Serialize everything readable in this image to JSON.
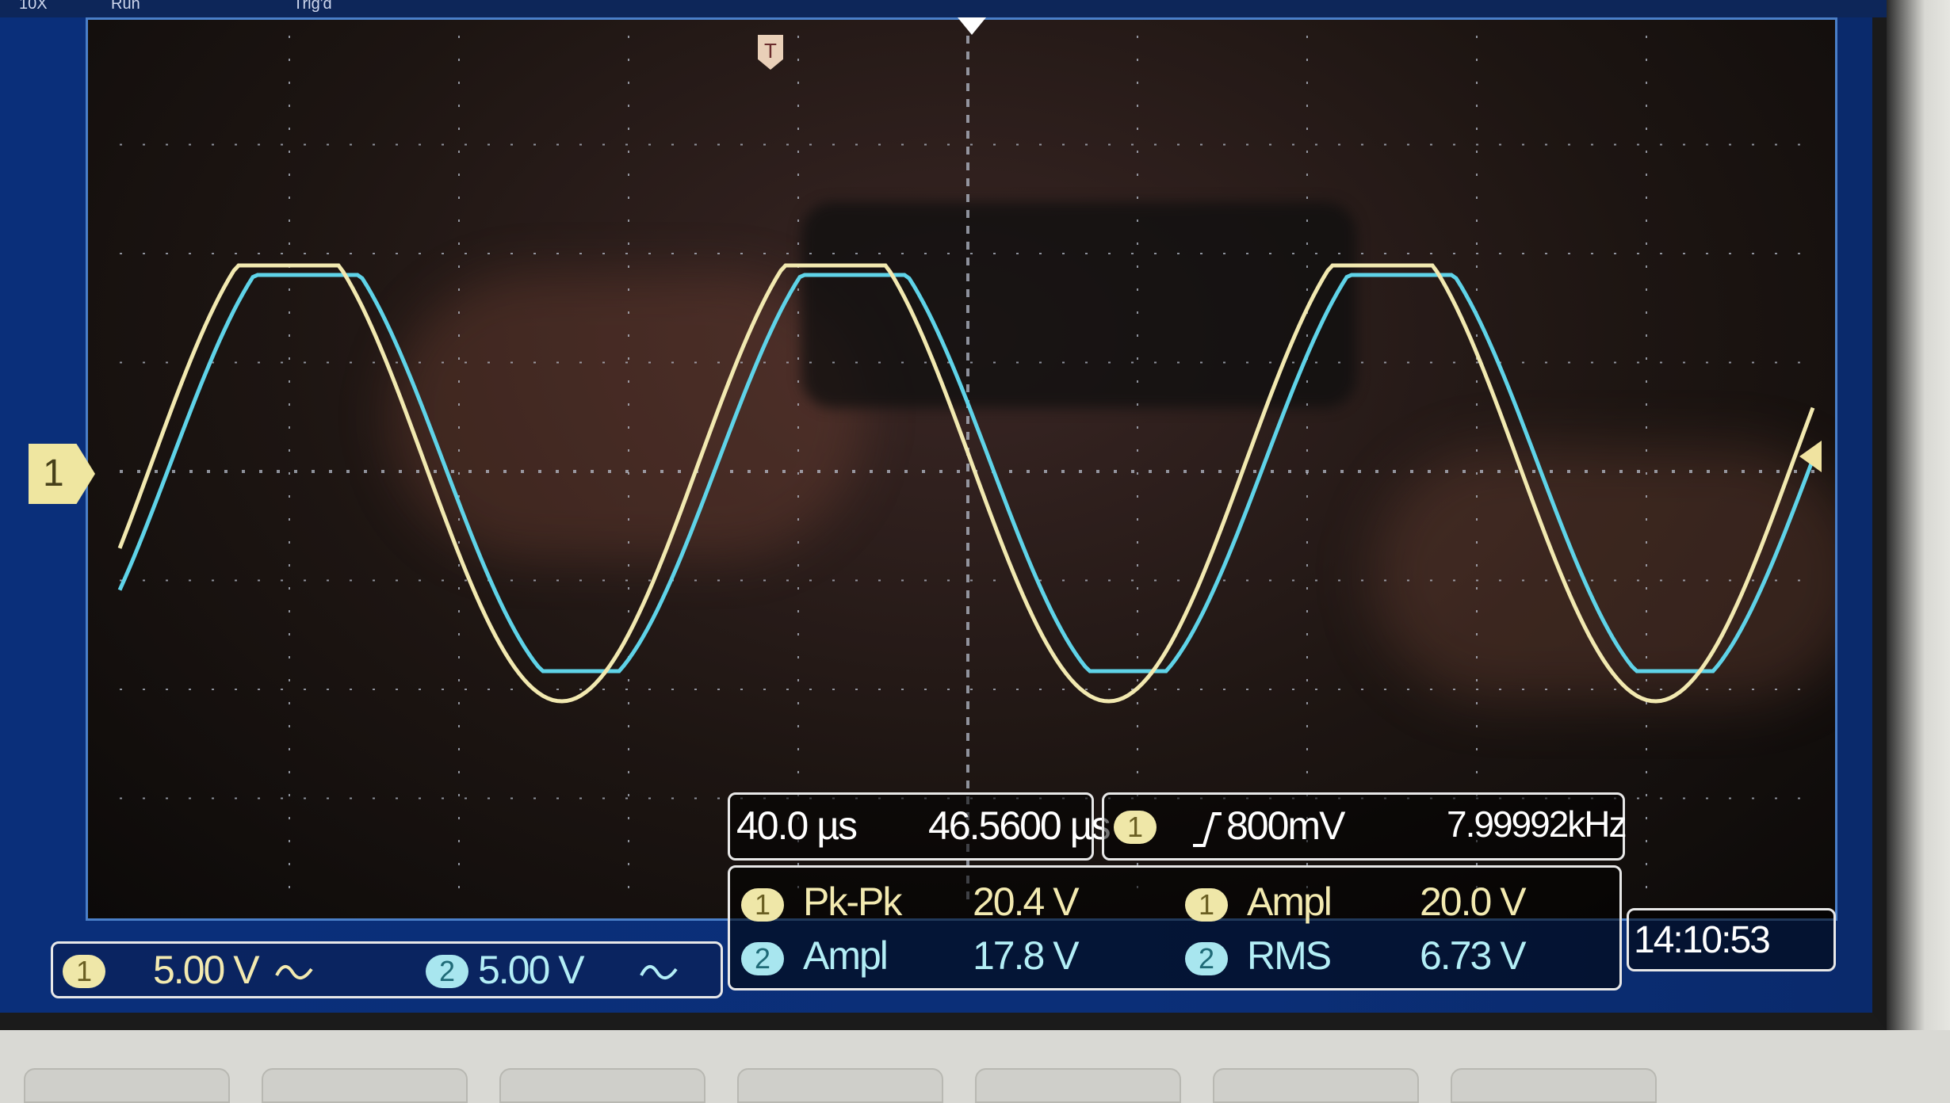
{
  "top_status": {
    "left": "10X",
    "mode": "Run",
    "trigger": "Trig'd"
  },
  "channel_marker": {
    "label": "1"
  },
  "trigger_marker": {
    "label": "T"
  },
  "timebase": {
    "scale": "40.0 µs",
    "delay": "46.5600 µs"
  },
  "trigger": {
    "source": "1",
    "slope_icon": "rising-edge-icon",
    "level": "800mV",
    "frequency": "7.99992kHz"
  },
  "measurements": [
    {
      "channel": "1",
      "name": "Pk-Pk",
      "value": "20.4 V"
    },
    {
      "channel": "1",
      "name": "Ampl",
      "value": "20.0 V"
    },
    {
      "channel": "2",
      "name": "Ampl",
      "value": "17.8 V"
    },
    {
      "channel": "2",
      "name": "RMS",
      "value": "6.73 V"
    }
  ],
  "channels": [
    {
      "id": "1",
      "scale": "5.00 V",
      "coupling_icon": "ac-coupling-icon"
    },
    {
      "id": "2",
      "scale": "5.00 V",
      "coupling_icon": "ac-coupling-icon"
    }
  ],
  "clock": "14:10:53",
  "colors": {
    "ch1": "#f2e9b0",
    "ch2": "#5fd3e8",
    "frame": "#4a7fc8",
    "grid": "#bfc7d6"
  }
}
